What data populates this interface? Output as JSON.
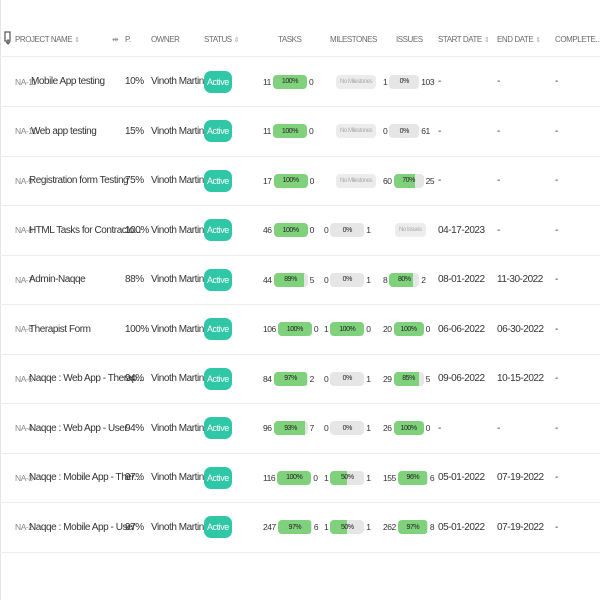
{
  "header": {
    "project_name": "PROJECT NAME",
    "progress": "P.",
    "owner": "OWNER",
    "status": "STATUS",
    "tasks": "TASKS",
    "milestones": "MILESTONES",
    "issues": "ISSUES",
    "start_date": "START DATE",
    "end_date": "END DATE",
    "completed": "COMPLETE..."
  },
  "colors": {
    "active": "#2fc7a6",
    "bar_fill": "#7fd27b",
    "bar_bg": "#e6e6e6"
  },
  "rows": [
    {
      "code": "NA-11",
      "name": "Mobile App testing",
      "pct": "10%",
      "owner": "Vinoth Martin S...",
      "status": "Active",
      "tasks": {
        "left": "11",
        "label": "100%",
        "right": "0",
        "fill": 1.0
      },
      "milestones": {
        "none": "No Milestones"
      },
      "issues": {
        "left": "1",
        "label": "0%",
        "right": "103",
        "fill": 0.0
      },
      "start": "-",
      "end": "-",
      "completed": "-"
    },
    {
      "code": "NA-10",
      "name": "Web app testing",
      "pct": "15%",
      "owner": "Vinoth Martin S...",
      "status": "Active",
      "tasks": {
        "left": "11",
        "label": "100%",
        "right": "0",
        "fill": 1.0
      },
      "milestones": {
        "none": "No Milestones"
      },
      "issues": {
        "left": "0",
        "label": "0%",
        "right": "61",
        "fill": 0.0
      },
      "start": "-",
      "end": "-",
      "completed": "-"
    },
    {
      "code": "NA-9",
      "name": "Registration form Testing",
      "pct": "75%",
      "owner": "Vinoth Martin S...",
      "status": "Active",
      "tasks": {
        "left": "17",
        "label": "100%",
        "right": "0",
        "fill": 1.0
      },
      "milestones": {
        "none": "No Milestones"
      },
      "issues": {
        "left": "60",
        "label": "70%",
        "right": "25",
        "fill": 0.7
      },
      "start": "-",
      "end": "-",
      "completed": "-"
    },
    {
      "code": "NA-8",
      "name": "HTML Tasks for Contracto...",
      "pct": "100%",
      "owner": "Vinoth Martin S...",
      "status": "Active",
      "tasks": {
        "left": "46",
        "label": "100%",
        "right": "0",
        "fill": 1.0
      },
      "milestones": {
        "left": "0",
        "label": "0%",
        "right": "1",
        "fill": 0.0
      },
      "issues": {
        "none": "No Issues"
      },
      "start": "04-17-2023",
      "end": "-",
      "completed": "-"
    },
    {
      "code": "NA-7",
      "name": "Admin-Naqqe",
      "pct": "88%",
      "owner": "Vinoth Martin S...",
      "status": "Active",
      "tasks": {
        "left": "44",
        "label": "89%",
        "right": "5",
        "fill": 0.89
      },
      "milestones": {
        "left": "0",
        "label": "0%",
        "right": "1",
        "fill": 0.0
      },
      "issues": {
        "left": "8",
        "label": "80%",
        "right": "2",
        "fill": 0.8
      },
      "start": "08-01-2022",
      "end": "11-30-2022",
      "completed": "-"
    },
    {
      "code": "NA-6",
      "name": "Therapist Form",
      "pct": "100%",
      "owner": "Vinoth Martin S...",
      "status": "Active",
      "tasks": {
        "left": "106",
        "label": "100%",
        "right": "0",
        "fill": 1.0
      },
      "milestones": {
        "left": "1",
        "label": "100%",
        "right": "0",
        "fill": 1.0
      },
      "issues": {
        "left": "20",
        "label": "100%",
        "right": "0",
        "fill": 1.0
      },
      "start": "06-06-2022",
      "end": "06-30-2022",
      "completed": "-"
    },
    {
      "code": "NA-5",
      "name": "Naqqe : Web App - Therap...",
      "pct": "94%",
      "owner": "Vinoth Martin S...",
      "status": "Active",
      "tasks": {
        "left": "84",
        "label": "97%",
        "right": "2",
        "fill": 0.97
      },
      "milestones": {
        "left": "0",
        "label": "0%",
        "right": "1",
        "fill": 0.0
      },
      "issues": {
        "left": "29",
        "label": "85%",
        "right": "5",
        "fill": 0.85
      },
      "start": "09-06-2022",
      "end": "10-15-2022",
      "completed": "-"
    },
    {
      "code": "NA-4",
      "name": "Naqqe : Web App - User",
      "pct": "94%",
      "owner": "Vinoth Martin S...",
      "status": "Active",
      "tasks": {
        "left": "96",
        "label": "93%",
        "right": "7",
        "fill": 0.93
      },
      "milestones": {
        "left": "0",
        "label": "0%",
        "right": "1",
        "fill": 0.0
      },
      "issues": {
        "left": "26",
        "label": "100%",
        "right": "0",
        "fill": 1.0
      },
      "start": "-",
      "end": "-",
      "completed": "-"
    },
    {
      "code": "NA-3",
      "name": "Naqqe : Mobile App - Ther...",
      "pct": "97%",
      "owner": "Vinoth Martin S...",
      "status": "Active",
      "tasks": {
        "left": "116",
        "label": "100%",
        "right": "0",
        "fill": 1.0
      },
      "milestones": {
        "left": "1",
        "label": "50%",
        "right": "1",
        "fill": 0.5
      },
      "issues": {
        "left": "155",
        "label": "96%",
        "right": "6",
        "fill": 0.96
      },
      "start": "05-01-2022",
      "end": "07-19-2022",
      "completed": "-"
    },
    {
      "code": "NA-2",
      "name": "Naqqe : Mobile App - User",
      "pct": "97%",
      "owner": "Vinoth Martin S...",
      "status": "Active",
      "tasks": {
        "left": "247",
        "label": "97%",
        "right": "6",
        "fill": 0.97
      },
      "milestones": {
        "left": "1",
        "label": "50%",
        "right": "1",
        "fill": 0.5
      },
      "issues": {
        "left": "262",
        "label": "97%",
        "right": "8",
        "fill": 0.97
      },
      "start": "05-01-2022",
      "end": "07-19-2022",
      "completed": "-"
    }
  ]
}
